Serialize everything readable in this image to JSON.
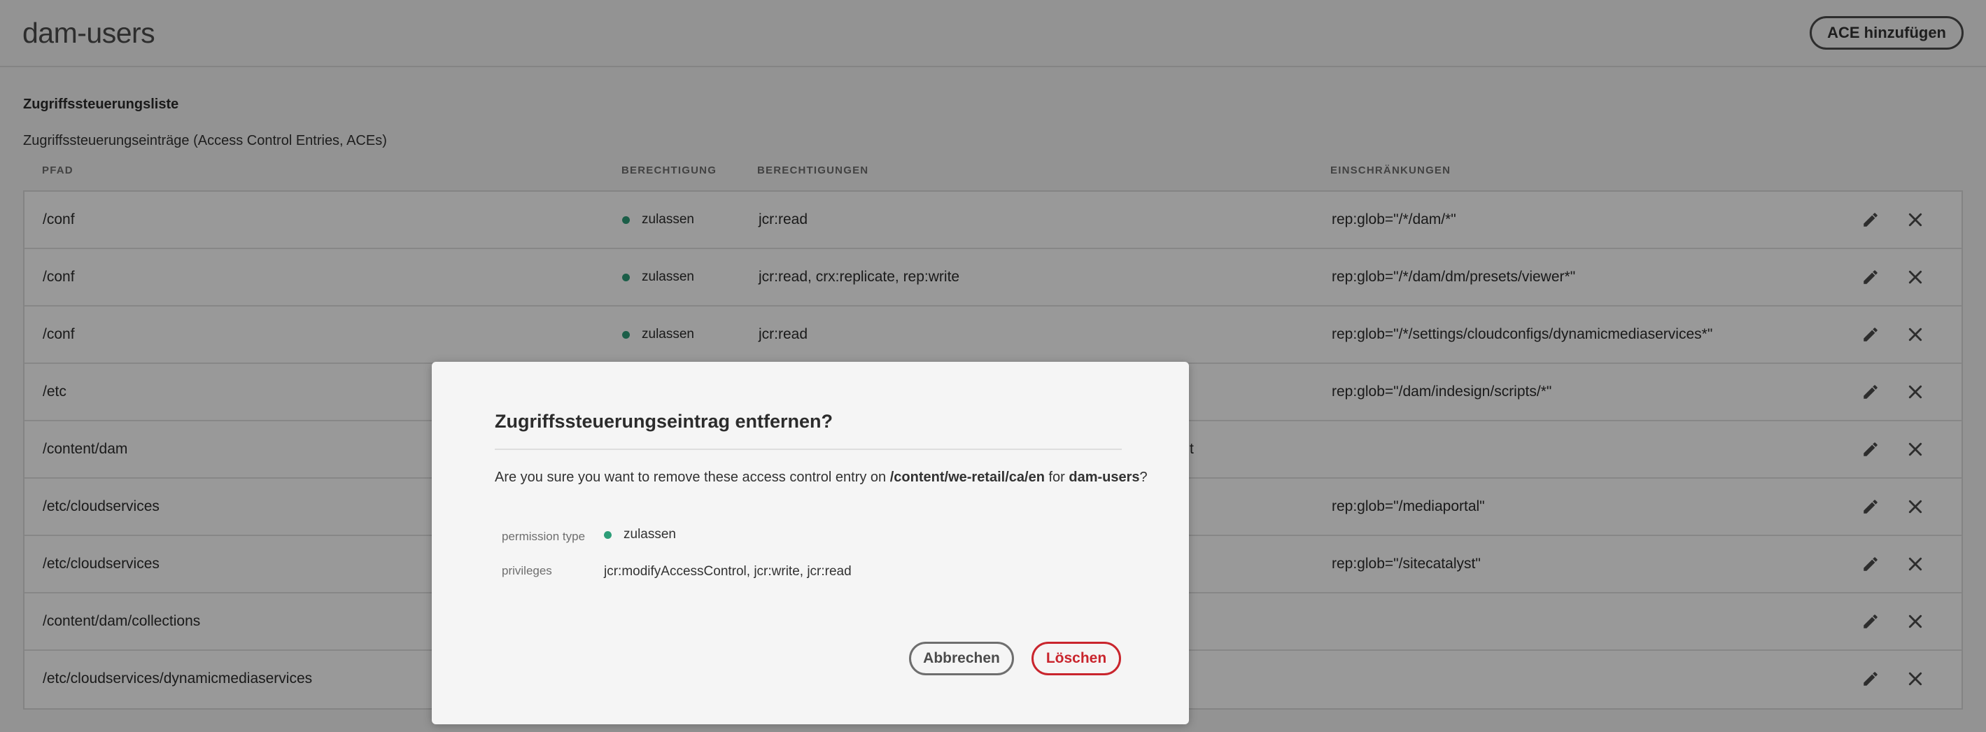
{
  "page": {
    "title": "dam-users",
    "add_ace_label": "ACE hinzufügen"
  },
  "acl": {
    "title": "Zugriffssteuerungsliste",
    "subtitle": "Zugriffssteuerungseinträge (Access Control Entries, ACEs)",
    "columns": {
      "path": "PFAD",
      "permission": "BERECHTIGUNG",
      "privileges": "BERECHTIGUNGEN",
      "restrictions": "EINSCHRÄNKUNGEN"
    },
    "rows": [
      {
        "path": "/conf",
        "type": "zulassen",
        "privileges": "jcr:read",
        "restrictions": "rep:glob=\"/*/dam/*\""
      },
      {
        "path": "/conf",
        "type": "zulassen",
        "privileges": "jcr:read, crx:replicate, rep:write",
        "restrictions": "rep:glob=\"/*/dam/dm/presets/viewer*\""
      },
      {
        "path": "/conf",
        "type": "zulassen",
        "privileges": "jcr:read",
        "restrictions": "rep:glob=\"/*/settings/cloudconfigs/dynamicmediaservices*\""
      },
      {
        "path": "/etc",
        "type": "",
        "privileges": "",
        "restrictions": "rep:glob=\"/dam/indesign/scripts/*\""
      },
      {
        "path": "/content/dam",
        "type": "",
        "privileges": "t",
        "restrictions": ""
      },
      {
        "path": "/etc/cloudservices",
        "type": "",
        "privileges": "",
        "restrictions": "rep:glob=\"/mediaportal\""
      },
      {
        "path": "/etc/cloudservices",
        "type": "",
        "privileges": "",
        "restrictions": "rep:glob=\"/sitecatalyst\""
      },
      {
        "path": "/content/dam/collections",
        "type": "",
        "privileges": "",
        "restrictions": ""
      },
      {
        "path": "/etc/cloudservices/dynamicmediaservices",
        "type": "",
        "privileges": "",
        "restrictions": ""
      }
    ]
  },
  "dialog": {
    "title": "Zugriffssteuerungseintrag entfernen?",
    "message_prefix": "Are you sure you want to remove these access control entry on ",
    "message_path": "/content/we-retail/ca/en",
    "message_for": " for ",
    "message_user": "dam-users",
    "message_suffix": "?",
    "permission_type_label": "permission type",
    "permission_type_value": "zulassen",
    "privileges_label": "privileges",
    "privileges_value": "jcr:modifyAccessControl, jcr:write, jcr:read",
    "cancel_label": "Abbrechen",
    "delete_label": "Löschen"
  },
  "colors": {
    "allow_dot": "#2d9d78",
    "delete_red": "#c9252d"
  },
  "icons": {
    "edit": "pencil-icon",
    "delete": "close-icon"
  }
}
